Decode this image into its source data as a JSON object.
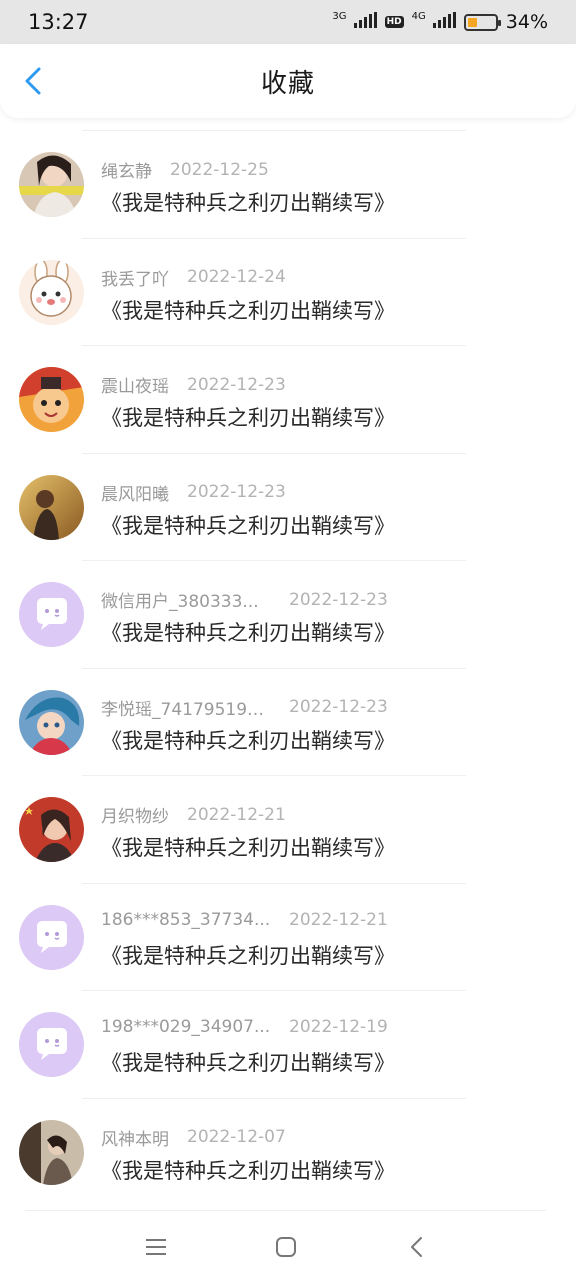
{
  "status": {
    "time": "13:27",
    "network1": "3G",
    "hd": "HD",
    "network2": "4G",
    "battery_percent": "34%",
    "battery_level": 0.34,
    "battery_color": "#f5a623"
  },
  "header": {
    "back_icon": "chevron-left-icon",
    "back_color": "#2f9bf0",
    "title": "收藏"
  },
  "items": [
    {
      "user": "绳玄静",
      "date": "2022-12-25",
      "book": "《我是特种兵之利刃出鞘续写》",
      "avatar": "photo"
    },
    {
      "user": "我丢了吖",
      "date": "2022-12-24",
      "book": "《我是特种兵之利刃出鞘续写》",
      "avatar": "cartoon-bunny"
    },
    {
      "user": "震山夜瑶",
      "date": "2022-12-23",
      "book": "《我是特种兵之利刃出鞘续写》",
      "avatar": "cartoon-orange"
    },
    {
      "user": "晨风阳曦",
      "date": "2022-12-23",
      "book": "《我是特种兵之利刃出鞘续写》",
      "avatar": "photo-field"
    },
    {
      "user": "微信用户_380333...",
      "date": "2022-12-23",
      "book": "《我是特种兵之利刃出鞘续写》",
      "avatar": "default-chat"
    },
    {
      "user": "李悦瑶_741795191...",
      "date": "2022-12-23",
      "book": "《我是特种兵之利刃出鞘续写》",
      "avatar": "anime-blue"
    },
    {
      "user": "月织物纱",
      "date": "2022-12-21",
      "book": "《我是特种兵之利刃出鞘续写》",
      "avatar": "photo-red"
    },
    {
      "user": "186***853_37734...",
      "date": "2022-12-21",
      "book": "《我是特种兵之利刃出鞘续写》",
      "avatar": "default-chat"
    },
    {
      "user": "198***029_34907...",
      "date": "2022-12-19",
      "book": "《我是特种兵之利刃出鞘续写》",
      "avatar": "default-chat"
    },
    {
      "user": "风神本明",
      "date": "2022-12-07",
      "book": "《我是特种兵之利刃出鞘续写》",
      "avatar": "photo-dark"
    }
  ],
  "navbar": {
    "menu_icon": "menu-icon",
    "home_icon": "home-icon",
    "back_icon": "back-icon"
  }
}
